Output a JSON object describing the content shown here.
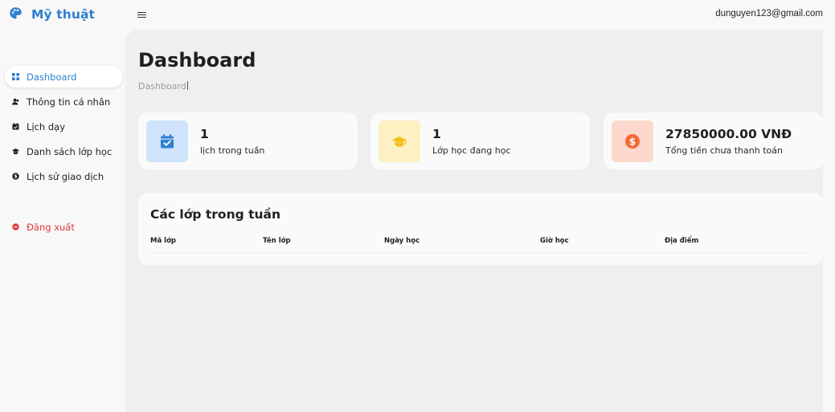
{
  "brand": {
    "name": "Mỹ thuật",
    "icon": "palette-icon",
    "accent": "#2f7fd1"
  },
  "header": {
    "menu_icon": "hamburger-icon",
    "user_email": "dunguyen123@gmail.com"
  },
  "sidebar": {
    "items": [
      {
        "label": "Dashboard",
        "icon": "grid-icon",
        "active": true
      },
      {
        "label": "Thông tin cá nhân",
        "icon": "user-icon"
      },
      {
        "label": "Lịch dạy",
        "icon": "calendar-icon"
      },
      {
        "label": "Danh sách lớp học",
        "icon": "graduation-cap-icon"
      },
      {
        "label": "Lịch sử giao dịch",
        "icon": "dollar-circle-icon"
      }
    ],
    "logout": {
      "label": "Đăng xuất",
      "icon": "logout-icon",
      "color": "#e23a3a"
    }
  },
  "main": {
    "title": "Dashboard",
    "breadcrumb": "Dashboard",
    "cards": [
      {
        "value": "1",
        "label": "lịch trong tuần",
        "icon": "calendar-check-icon",
        "icon_bg": "#cfe3fb",
        "icon_color": "#2f7fd1"
      },
      {
        "value": "1",
        "label": "Lớp học đang học",
        "icon": "graduation-cap-icon",
        "icon_bg": "#fdf0c2",
        "icon_color": "#f2bf1f"
      },
      {
        "value": "27850000.00 VNĐ",
        "label": "Tổng tiền chưa thanh toán",
        "icon": "dollar-circle-icon",
        "icon_bg": "#fcd9cc",
        "icon_color": "#f26b35"
      }
    ],
    "table": {
      "title": "Các lớp trong tuần",
      "columns": [
        "Mã lớp",
        "Tên lớp",
        "Ngày học",
        "Giờ học",
        "Địa điểm"
      ],
      "rows": []
    }
  }
}
